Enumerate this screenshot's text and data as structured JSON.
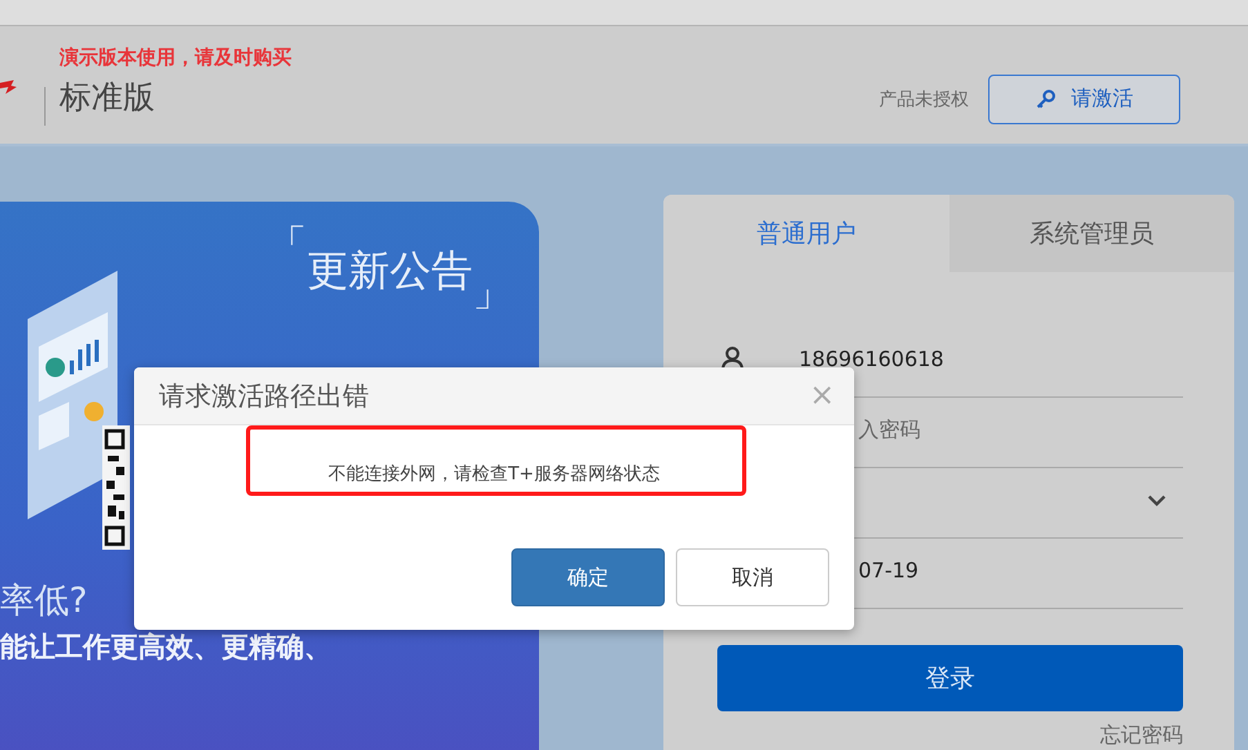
{
  "header": {
    "notice": "演示版本使用，请及时购买",
    "edition": "标准版",
    "license_status": "产品未授权",
    "activate_button": "请激活"
  },
  "announcement": {
    "bracket_open": "「",
    "title": "更新公告",
    "bracket_close": "」",
    "caption_1": "率低?",
    "caption_2": "能让工作更高效、更精确、"
  },
  "login": {
    "tabs": [
      {
        "label": "普通用户",
        "selected": true
      },
      {
        "label": "系统管理员",
        "selected": false
      }
    ],
    "fields": [
      {
        "kind": "user",
        "value": "18696160618"
      },
      {
        "kind": "password",
        "placeholder": "入密码"
      },
      {
        "kind": "select"
      },
      {
        "kind": "date",
        "value": "07-19"
      }
    ],
    "submit": "登录",
    "forgot": "忘记密码"
  },
  "dialog": {
    "title": "请求激活路径出错",
    "close": "×",
    "message": "不能连接外网，请检查T+服务器网络状态",
    "buttons": [
      {
        "kind": "primary",
        "label": "确定"
      },
      {
        "kind": "secondary",
        "label": "取消"
      }
    ]
  }
}
